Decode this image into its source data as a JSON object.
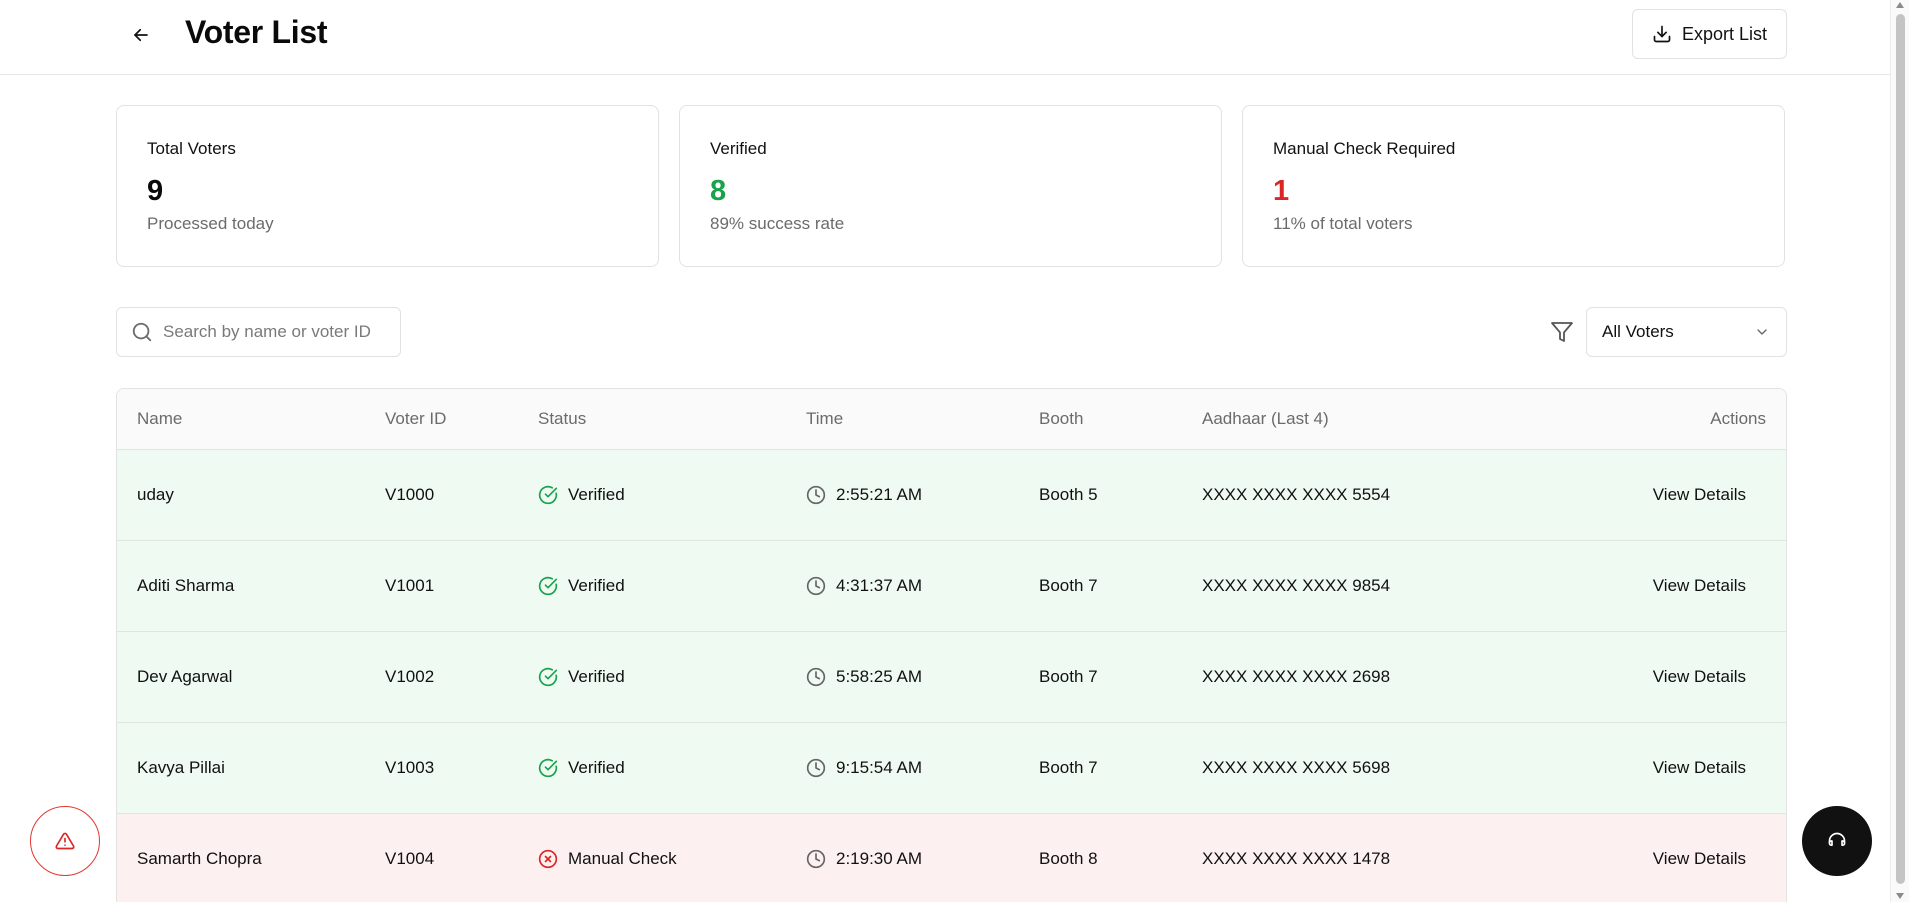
{
  "header": {
    "title": "Voter List",
    "export_label": "Export List"
  },
  "stats": {
    "total": {
      "label": "Total Voters",
      "value": "9",
      "sub": "Processed today",
      "color": "#0a0a0a"
    },
    "verified": {
      "label": "Verified",
      "value": "8",
      "sub": "89% success rate",
      "color": "#16a34a"
    },
    "manual": {
      "label": "Manual Check Required",
      "value": "1",
      "sub": "11% of total voters",
      "color": "#dc2626"
    }
  },
  "search": {
    "placeholder": "Search by name or voter ID",
    "value": ""
  },
  "filter": {
    "selected": "All Voters"
  },
  "table": {
    "columns": [
      "Name",
      "Voter ID",
      "Status",
      "Time",
      "Booth",
      "Aadhaar (Last 4)",
      "Actions"
    ],
    "rows": [
      {
        "name": "uday",
        "voter_id": "V1000",
        "status": "Verified",
        "time": "2:55:21 AM",
        "booth": "Booth 5",
        "aadhaar": "XXXX XXXX XXXX 5554",
        "action": "View Details"
      },
      {
        "name": "Aditi Sharma",
        "voter_id": "V1001",
        "status": "Verified",
        "time": "4:31:37 AM",
        "booth": "Booth 7",
        "aadhaar": "XXXX XXXX XXXX 9854",
        "action": "View Details"
      },
      {
        "name": "Dev Agarwal",
        "voter_id": "V1002",
        "status": "Verified",
        "time": "5:58:25 AM",
        "booth": "Booth 7",
        "aadhaar": "XXXX XXXX XXXX 2698",
        "action": "View Details"
      },
      {
        "name": "Kavya Pillai",
        "voter_id": "V1003",
        "status": "Verified",
        "time": "9:15:54 AM",
        "booth": "Booth 7",
        "aadhaar": "XXXX XXXX XXXX 5698",
        "action": "View Details"
      },
      {
        "name": "Samarth Chopra",
        "voter_id": "V1004",
        "status": "Manual Check",
        "time": "2:19:30 AM",
        "booth": "Booth 8",
        "aadhaar": "XXXX XXXX XXXX 1478",
        "action": "View Details"
      }
    ]
  },
  "colors": {
    "verified_green": "#16a34a",
    "manual_red": "#dc2626",
    "verified_row_bg": "#effbf2",
    "manual_row_bg": "#fdf0f0"
  },
  "icons": {
    "back": "arrow-left-icon",
    "export": "download-icon",
    "search": "search-icon",
    "filter": "filter-icon",
    "dropdown": "chevron-down-icon",
    "verified": "check-circle-icon",
    "manual": "x-circle-icon",
    "time": "clock-icon",
    "alert": "alert-triangle-icon",
    "support": "headset-icon"
  }
}
